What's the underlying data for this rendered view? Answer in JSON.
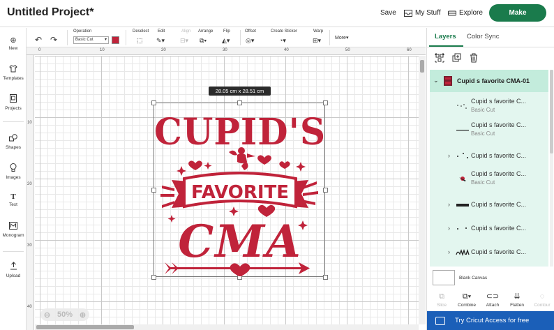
{
  "topbar": {
    "title": "Untitled Project*",
    "save": "Save",
    "my_stuff": "My Stuff",
    "explore": "Explore",
    "make": "Make"
  },
  "sidebar": {
    "items": [
      {
        "label": "New",
        "icon": "plus-icon"
      },
      {
        "label": "Templates",
        "icon": "shirt-icon"
      },
      {
        "label": "Projects",
        "icon": "projects-icon"
      },
      {
        "label": "Shapes",
        "icon": "shapes-icon"
      },
      {
        "label": "Images",
        "icon": "lightbulb-icon"
      },
      {
        "label": "Text",
        "icon": "text-icon"
      },
      {
        "label": "Monogram",
        "icon": "monogram-icon"
      },
      {
        "label": "Upload",
        "icon": "upload-icon"
      }
    ]
  },
  "toolbar": {
    "operation_label": "Operation",
    "operation_value": "Basic Cut",
    "operation_color": "#c0233a",
    "deselect": "Deselect",
    "edit": "Edit",
    "align": "Align",
    "arrange": "Arrange",
    "flip": "Flip",
    "offset": "Offset",
    "create_sticker": "Create Sticker",
    "warp": "Warp",
    "more": "More"
  },
  "rulers": {
    "top": [
      "0",
      "10",
      "20",
      "30",
      "40",
      "50",
      "60"
    ],
    "left": [
      "10",
      "20",
      "30",
      "40"
    ]
  },
  "canvas": {
    "dimension_label": "28.05 cm x 28.51 cm",
    "zoom": "50%",
    "design": {
      "line1": "CUPID'S",
      "line2": "FAVORITE",
      "line3": "CMA",
      "color": "#c0233a"
    }
  },
  "panel": {
    "tabs": [
      "Layers",
      "Color Sync"
    ],
    "group_name": "Cupid s favorite CMA-01",
    "layers": [
      {
        "name": "Cupid s favorite C...",
        "sub": "Basic Cut",
        "expandable": false
      },
      {
        "name": "Cupid s favorite C...",
        "sub": "Basic Cut",
        "expandable": false
      },
      {
        "name": "Cupid s favorite C...",
        "sub": "",
        "expandable": true
      },
      {
        "name": "Cupid s favorite C...",
        "sub": "Basic Cut",
        "expandable": false
      },
      {
        "name": "Cupid s favorite C...",
        "sub": "",
        "expandable": true
      },
      {
        "name": "Cupid s favorite C...",
        "sub": "",
        "expandable": true
      },
      {
        "name": "Cupid s favorite C...",
        "sub": "",
        "expandable": true
      }
    ],
    "blank_canvas": "Blank Canvas",
    "bottom_tools": [
      "Slice",
      "Combine",
      "Attach",
      "Flatten",
      "Contour"
    ],
    "access_banner": "Try Cricut Access for free"
  },
  "colors": {
    "brand_green": "#1a7b4c",
    "access_blue": "#1b5fb8",
    "layer_bg": "#e3f6ef",
    "design_red": "#c0233a"
  }
}
